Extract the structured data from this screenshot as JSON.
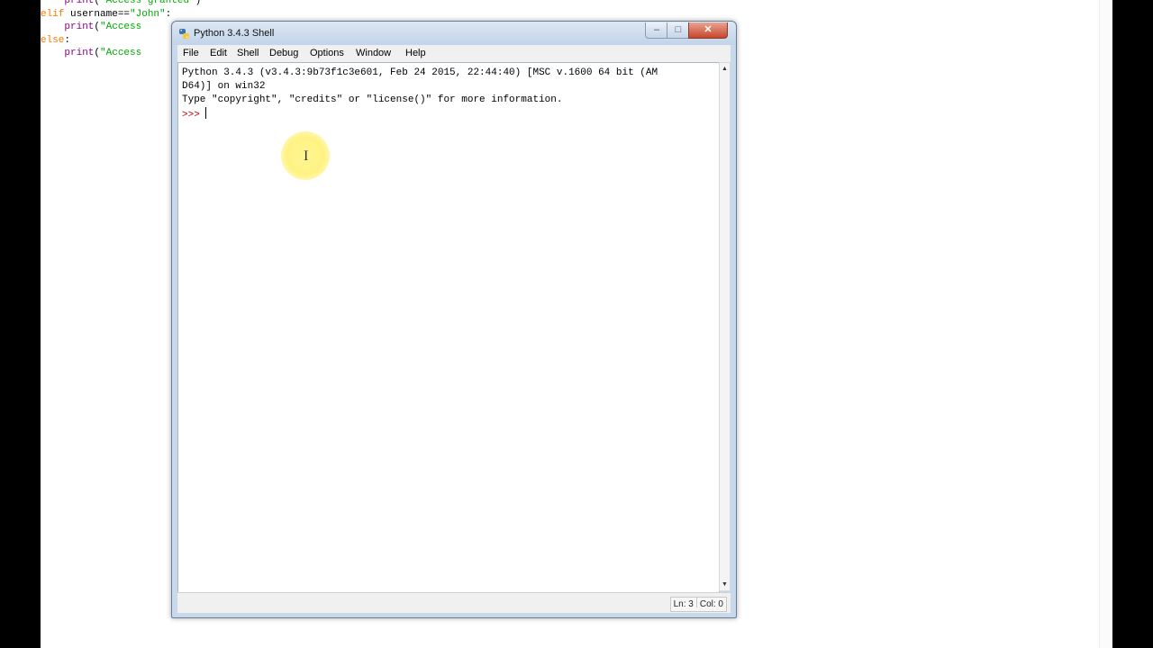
{
  "background_code": {
    "lines": [
      {
        "indent": "    ",
        "parts": [
          {
            "t": "print",
            "c": "fn"
          },
          {
            "t": "(",
            "c": ""
          },
          {
            "t": "\"Access granted\"",
            "c": "str"
          },
          {
            "t": ")",
            "c": ""
          }
        ]
      },
      {
        "indent": "",
        "parts": [
          {
            "t": "elif",
            "c": "kw"
          },
          {
            "t": " username==",
            "c": ""
          },
          {
            "t": "\"John\"",
            "c": "str"
          },
          {
            "t": ":",
            "c": ""
          }
        ]
      },
      {
        "indent": "    ",
        "parts": [
          {
            "t": "print",
            "c": "fn"
          },
          {
            "t": "(",
            "c": ""
          },
          {
            "t": "\"Access",
            "c": "str"
          }
        ]
      },
      {
        "indent": "",
        "parts": [
          {
            "t": "else",
            "c": "kw"
          },
          {
            "t": ":",
            "c": ""
          }
        ]
      },
      {
        "indent": "    ",
        "parts": [
          {
            "t": "print",
            "c": "fn"
          },
          {
            "t": "(",
            "c": ""
          },
          {
            "t": "\"Access",
            "c": "str"
          }
        ]
      }
    ]
  },
  "window": {
    "title": "Python 3.4.3 Shell",
    "controls": {
      "minimize": "–",
      "maximize": "□",
      "close": "✕"
    }
  },
  "menu": [
    "File",
    "Edit",
    "Shell",
    "Debug",
    "Options",
    "Window",
    "Help"
  ],
  "shell": {
    "banner_line1": "Python 3.4.3 (v3.4.3:9b73f1c3e601, Feb 24 2015, 22:44:40) [MSC v.1600 64 bit (AM",
    "banner_line2": "D64)] on win32",
    "banner_line3": "Type \"copyright\", \"credits\" or \"license()\" for more information.",
    "prompt": ">>> "
  },
  "status": {
    "line": "Ln: 3",
    "col": "Col: 0"
  },
  "icons": {
    "app": "python-icon",
    "cursor": "ibeam-cursor-icon"
  },
  "colors": {
    "prompt": "#c00000",
    "keyword": "#ff7700",
    "string": "#00aa00",
    "builtin": "#900090"
  }
}
